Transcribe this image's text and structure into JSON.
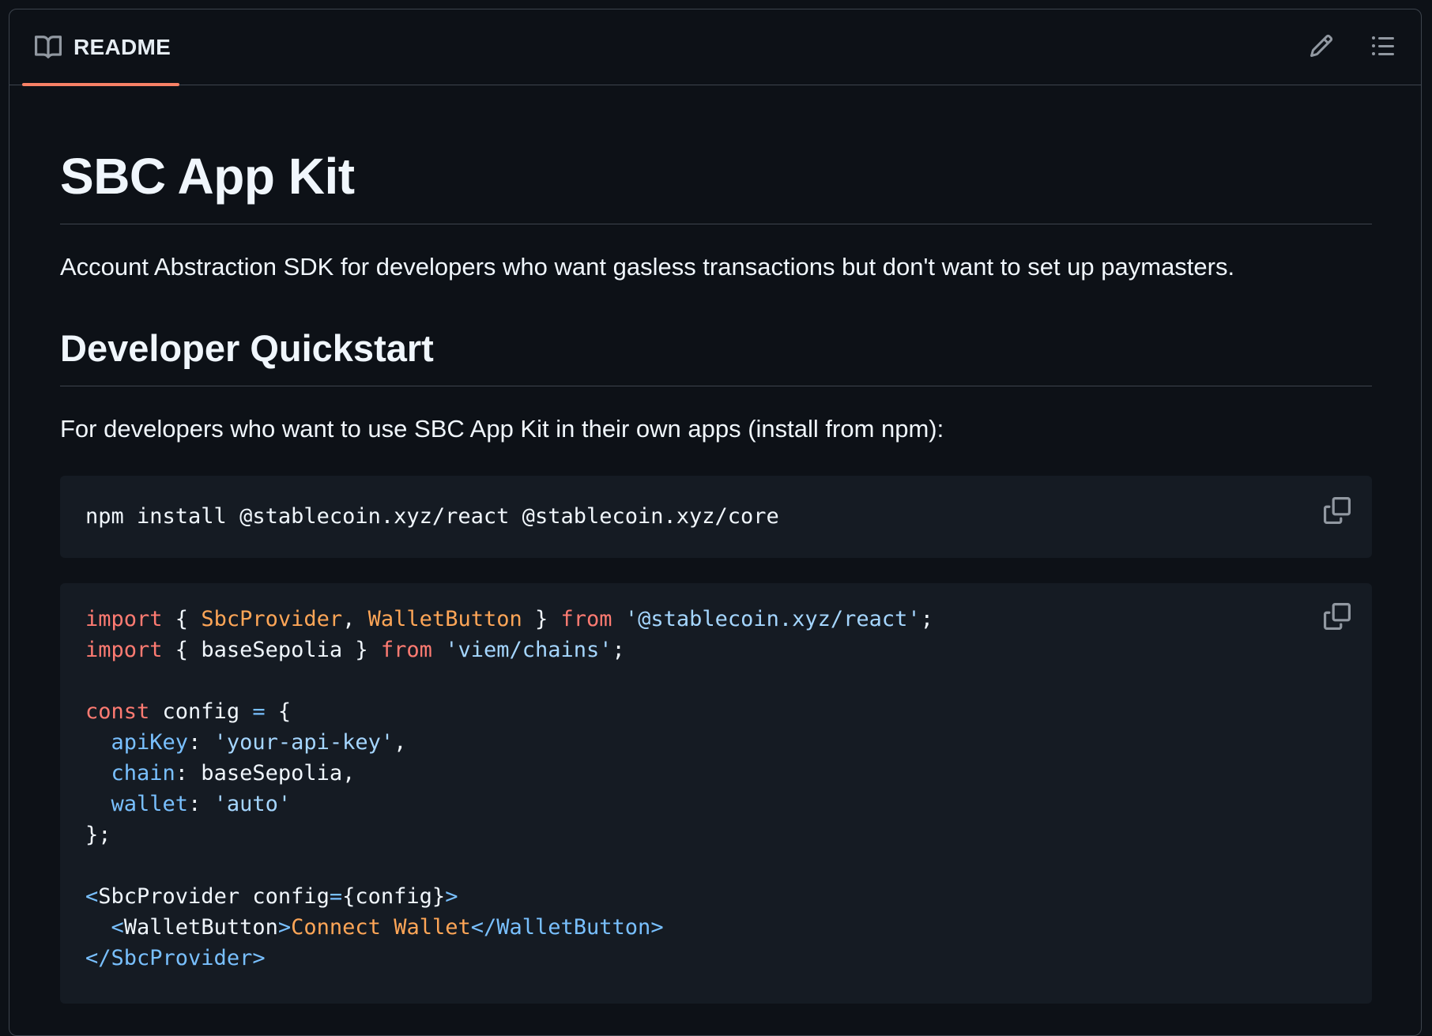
{
  "header": {
    "tab_label": "README",
    "tab_icon": "book-icon",
    "edit_icon": "pencil-icon",
    "outline_icon": "list-unordered-icon",
    "accent_color": "#f78166"
  },
  "article": {
    "title": "SBC App Kit",
    "intro": "Account Abstraction SDK for developers who want gasless transactions but don't want to set up paymasters.",
    "section_heading": "Developer Quickstart",
    "section_intro": "For developers who want to use SBC App Kit in their own apps (install from npm):"
  },
  "code_blocks": {
    "install": {
      "text": "npm install @stablecoin.xyz/react @stablecoin.xyz/core",
      "copy_icon": "copy-icon"
    },
    "usage": {
      "copy_icon": "copy-icon",
      "line1": {
        "kw_import": "import",
        "brace_open": " { ",
        "sbc_provider": "SbcProvider",
        "comma": ", ",
        "wallet_button": "WalletButton",
        "brace_close": " } ",
        "kw_from": "from",
        "space": " ",
        "module": "'@stablecoin.xyz/react'",
        "semi": ";"
      },
      "line2": {
        "kw_import": "import",
        "middle": " { baseSepolia } ",
        "kw_from": "from",
        "space": " ",
        "module": "'viem/chains'",
        "semi": ";"
      },
      "line4": {
        "kw_const": "const",
        "name": " config ",
        "eq": "=",
        "brace": " {"
      },
      "line5": {
        "indent": "  ",
        "key": "apiKey",
        "colon": ": ",
        "value": "'your-api-key'",
        "comma": ","
      },
      "line6": {
        "indent": "  ",
        "key": "chain",
        "rest": ": baseSepolia,"
      },
      "line7": {
        "indent": "  ",
        "key": "wallet",
        "colon": ": ",
        "value": "'auto'"
      },
      "line8": {
        "text": "};"
      },
      "line10": {
        "lt": "<",
        "tag": "SbcProvider",
        "attr": " config",
        "eq": "=",
        "expr": "{config}",
        "gt": ">"
      },
      "line11": {
        "indent": "  ",
        "lt": "<",
        "tag": "WalletButton",
        "gt": ">",
        "child_a": "Connect",
        "child_space": " ",
        "child_b": "Wallet",
        "close_lt": "</",
        "close_tag": "WalletButton",
        "close_gt": ">"
      },
      "line12": {
        "close_lt": "</",
        "close_tag": "SbcProvider",
        "close_gt": ">"
      }
    }
  }
}
